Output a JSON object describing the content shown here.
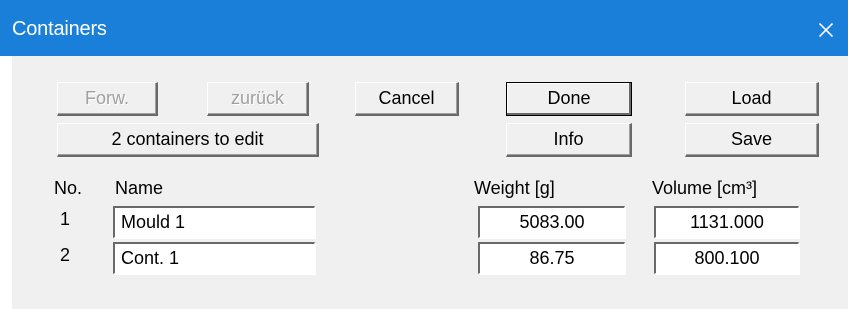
{
  "window": {
    "title": "Containers",
    "close_glyph": "×",
    "titlebar_color": "#1a7fd8"
  },
  "buttons": {
    "forward": "Forw.",
    "back": "zurück",
    "cancel": "Cancel",
    "done": "Done",
    "load": "Load",
    "edit_count": "2 containers to edit",
    "info": "Info",
    "save": "Save"
  },
  "table": {
    "headers": {
      "no": "No.",
      "name": "Name",
      "weight": "Weight [g]",
      "volume": "Volume [cm³]"
    },
    "rows": [
      {
        "no": "1",
        "name": "Mould 1",
        "weight": "5083.00",
        "volume": "1131.000"
      },
      {
        "no": "2",
        "name": "Cont. 1",
        "weight": "86.75",
        "volume": "800.100"
      }
    ]
  }
}
